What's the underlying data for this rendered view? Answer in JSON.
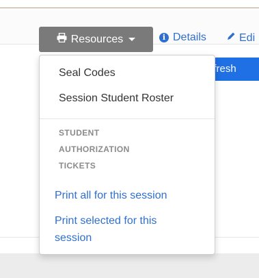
{
  "toolbar": {
    "resources_label": "Resources",
    "details_label": "Details",
    "edit_label": "Edi",
    "refresh_label": "efresh"
  },
  "resources_menu": {
    "items": [
      {
        "label": "Seal Codes"
      },
      {
        "label": "Session Student Roster"
      }
    ],
    "section_header_lines": [
      "STUDENT",
      "AUTHORIZATION",
      "TICKETS"
    ],
    "links": [
      {
        "label": "Print all for this session"
      },
      {
        "label_lines": [
          "Print selected for this",
          "session"
        ]
      }
    ]
  },
  "colors": {
    "button_gray": "#7a7a7a",
    "link_blue": "#2e6fd0",
    "primary_blue": "#1f6fe5"
  },
  "icons": {
    "resources": "print-icon",
    "details": "info-circle-icon",
    "edit": "pencil-icon",
    "dropdown": "caret-down-icon"
  }
}
